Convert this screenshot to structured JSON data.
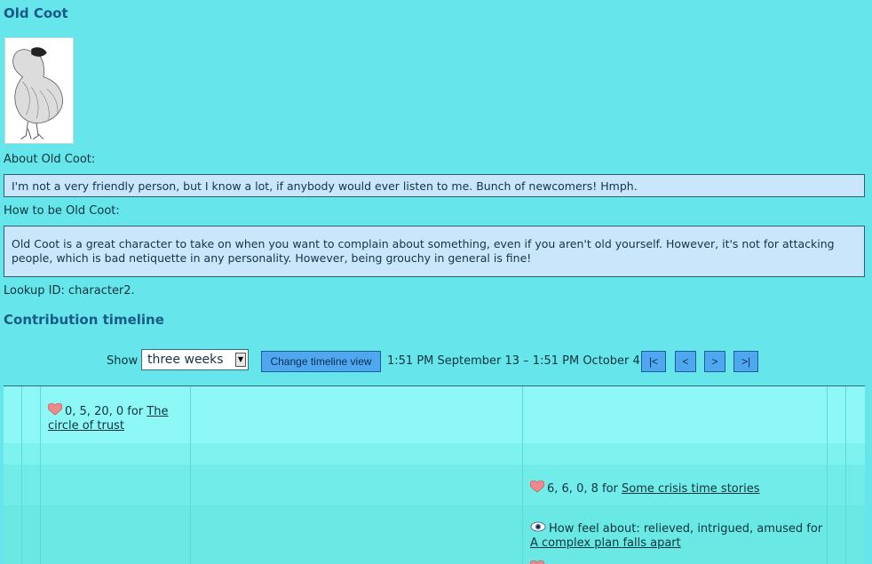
{
  "profile": {
    "name": "Old Coot",
    "about_label": "About Old Coot:",
    "about_text": "I'm not a very friendly person, but I know a lot, if anybody would ever listen to me. Bunch of newcomers! Hmph.",
    "how_label": "How to be Old Coot:",
    "how_text": "Old Coot is a great character to take on when you want to complain about something, even if you aren't old yourself. However, it's not for attacking people, which is bad netiquette in any personality. However, being grouchy in general is fine!",
    "lookup": "Lookup ID: character2."
  },
  "timeline": {
    "heading": "Contribution timeline",
    "show_label": "Show",
    "select_value": "three weeks",
    "change_button": "Change timeline view",
    "range_text": "1:51 PM September 13 – 1:51 PM October 4",
    "nav": {
      "first": "|<",
      "prev": "<",
      "next": ">",
      "last": ">|"
    },
    "entries": [
      {
        "values": "0, 5, 20, 0 for",
        "link": "The circle of trust",
        "icon": "heart-icon"
      },
      {
        "values": "6, 6, 0, 8 for",
        "link": "Some crisis time stories",
        "icon": "heart-icon"
      },
      {
        "values": "How feel about: relieved, intrigued, amused for",
        "link": "A complex plan falls apart",
        "icon": "eye-icon"
      }
    ]
  },
  "colors": {
    "background": "#66e6ea",
    "heading": "#1a5a86",
    "box": "#c9e6fa",
    "button": "#4fa7f0"
  }
}
